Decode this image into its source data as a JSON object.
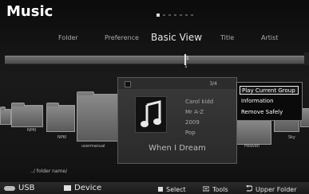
{
  "header": {
    "title": "Music"
  },
  "views": {
    "items": [
      "Folder",
      "Preference",
      "Basic View",
      "Title",
      "Artist"
    ],
    "active": "Basic View"
  },
  "slider": {
    "position_value": "1",
    "count": "1"
  },
  "thumbnails": {
    "labels": [
      "NPKI",
      "NPKI",
      "usermanual",
      "Heaven",
      "Sky"
    ]
  },
  "current_item": {
    "index": "3/4",
    "artist": "Carol kidd",
    "album": "Mr A-Z",
    "year": "2009",
    "genre": "Pop",
    "title": "When I Dream"
  },
  "popup_menu": {
    "items": [
      "Play Current Group",
      "Information",
      "Remove Safely"
    ],
    "selected_index": 0
  },
  "path": {
    "folder": "../ folder name/"
  },
  "footer": {
    "usb_label": "USB",
    "device_label": "Device",
    "select_label": "Select",
    "tools_label": "Tools",
    "upper_folder_label": "Upper Folder"
  },
  "colors": {
    "background": "#0d0d0d",
    "accent_border": "#eeeeee"
  }
}
